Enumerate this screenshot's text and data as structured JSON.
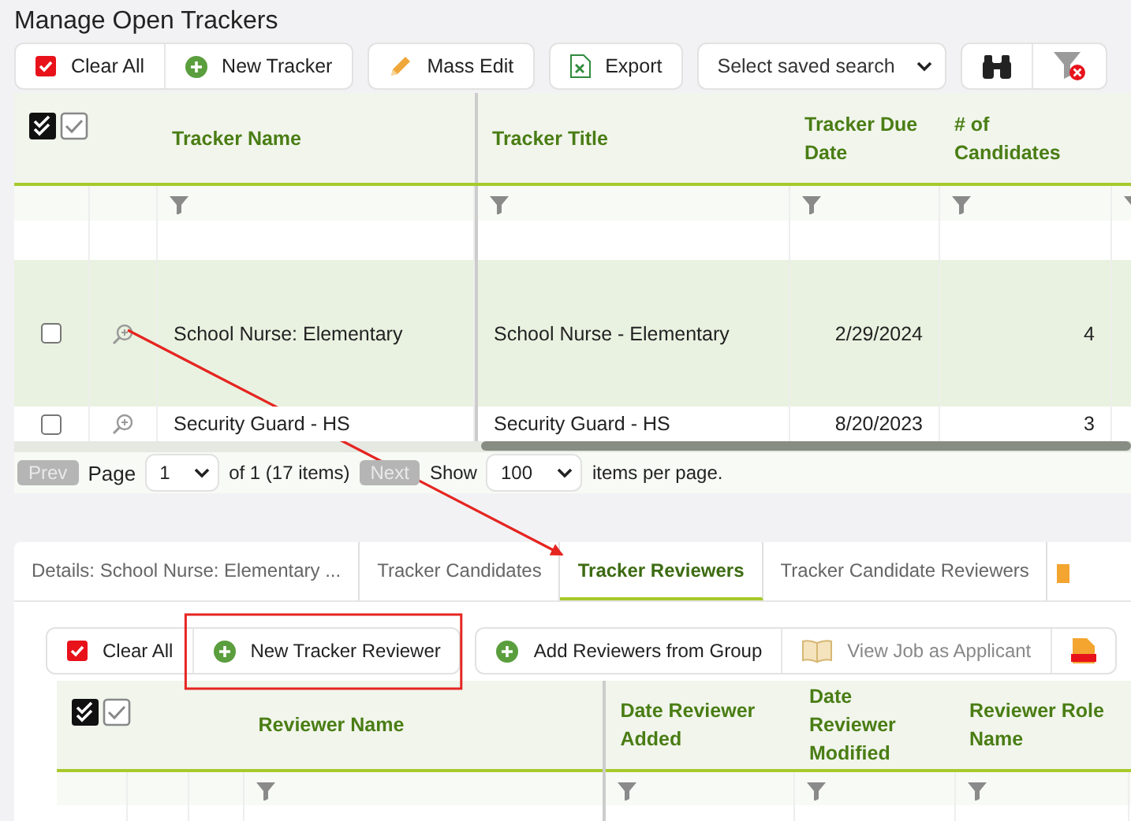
{
  "page_title": "Manage Open Trackers",
  "toolbar": [
    [
      {
        "kind": "check",
        "label": "Clear All"
      },
      {
        "kind": "add",
        "label": "New Tracker"
      }
    ],
    [
      {
        "kind": "pencil",
        "label": "Mass Edit"
      }
    ],
    [
      {
        "kind": "excel",
        "label": "Export"
      }
    ],
    [
      {
        "kind": "select",
        "label": "Select saved search"
      }
    ],
    [
      {
        "kind": "binoculars"
      },
      {
        "kind": "clear-filter"
      }
    ]
  ],
  "trackers": {
    "columns": [
      "Tracker Name",
      "Tracker Title",
      "Tracker Due Date",
      "# of Candidates"
    ],
    "rows": [
      {
        "checked": false,
        "active": true,
        "name": "School Nurse: Elementary",
        "title": "School Nurse - Elementary",
        "due": "2/29/2024",
        "candidates": "4"
      },
      {
        "checked": false,
        "active": false,
        "name": "Security Guard - HS",
        "title": "Security Guard - HS",
        "due": "8/20/2023",
        "candidates": "3"
      }
    ]
  },
  "pager": {
    "prev": "Prev",
    "page_label": "Page",
    "page": "1",
    "of": "of 1 (17 items)",
    "next": "Next",
    "show": "Show",
    "per_page": "100",
    "suffix": "items per page."
  },
  "tabs": [
    {
      "label": "Details: School Nurse: Elementary ...",
      "selected": false
    },
    {
      "label": "Tracker Candidates",
      "selected": false
    },
    {
      "label": "Tracker Reviewers",
      "selected": true
    },
    {
      "label": "Tracker Candidate Reviewers",
      "selected": false
    }
  ],
  "reviewer_toolbar": [
    [
      {
        "kind": "check",
        "label": "Clear All",
        "disabled": false
      },
      {
        "kind": "add",
        "label": "New Tracker Reviewer",
        "disabled": false
      }
    ],
    [
      {
        "kind": "add",
        "label": "Add Reviewers from Group",
        "disabled": false
      },
      {
        "kind": "book",
        "label": "View Job as Applicant",
        "disabled": true
      },
      {
        "kind": "pdf"
      }
    ]
  ],
  "reviewers": {
    "columns": [
      "Reviewer Name",
      "Date Reviewer Added",
      "Date Reviewer Modified",
      "Reviewer Role Name"
    ]
  },
  "annotations": {
    "arrow": true,
    "highlight_box": true
  }
}
